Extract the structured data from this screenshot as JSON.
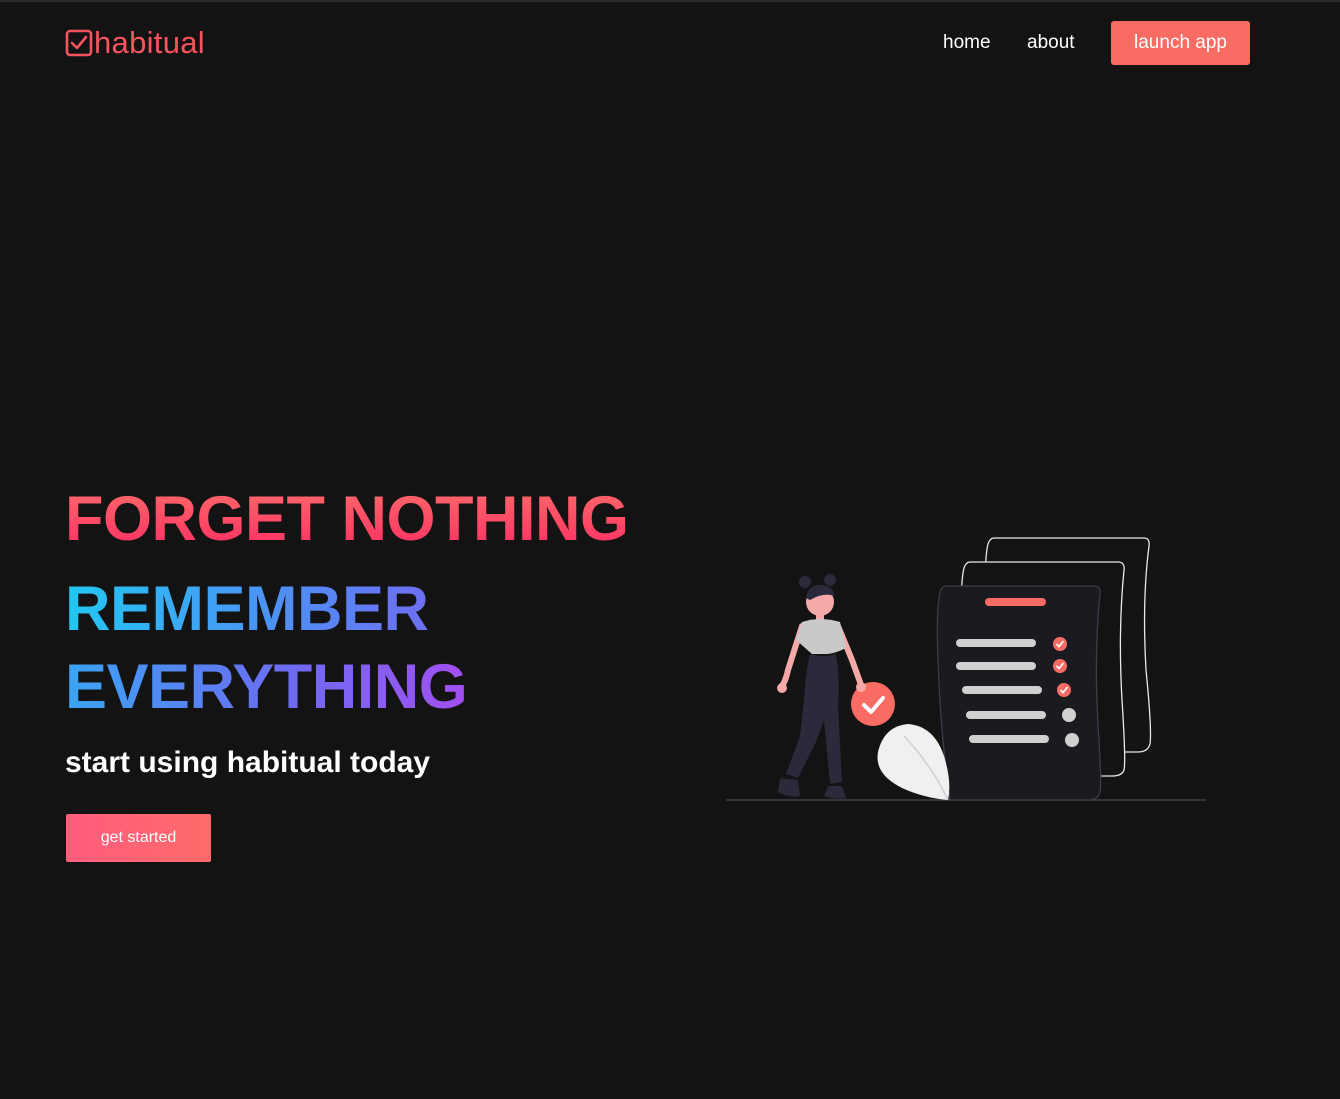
{
  "brand": {
    "name": "habitual",
    "color": "#f8545e",
    "icon": "checkbox-icon"
  },
  "nav": {
    "home_label": "home",
    "about_label": "about",
    "launch_label": "launch app",
    "launch_color": "#f96c63"
  },
  "hero": {
    "line1": "FORGET NOTHING",
    "line2": "REMEMBER",
    "line3": "EVERYTHING",
    "subtitle": "start using habitual today",
    "cta_label": "get started"
  },
  "illustration": {
    "icon": "woman-checklist-illustration",
    "checklist_items": [
      {
        "done": true
      },
      {
        "done": true
      },
      {
        "done": true
      },
      {
        "done": false
      },
      {
        "done": false
      }
    ]
  },
  "colors": {
    "background": "#131313",
    "accent": "#f96c63",
    "gradient_red": "#ff2e63",
    "gradient_blue": "#22c7f2",
    "gradient_purple": "#a24ff0"
  }
}
